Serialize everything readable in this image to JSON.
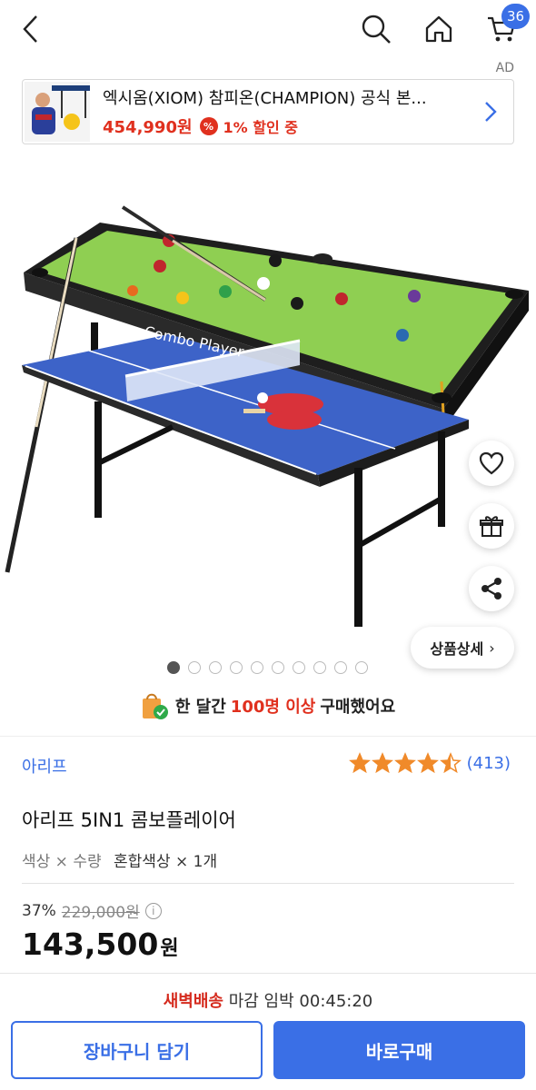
{
  "header": {
    "cart_count": "36",
    "ad_label": "AD"
  },
  "ad": {
    "title": "엑시옴(XIOM) 참피온(CHAMPION) 공식 본...",
    "price": "454,990원",
    "pct_icon": "%",
    "discount": "1% 할인 중"
  },
  "gallery": {
    "total_images": 10,
    "current_index": 1,
    "detail_label": "상품상세"
  },
  "notice": {
    "prefix": "한 달간",
    "highlight": "100명 이상",
    "suffix": "구매했어요"
  },
  "product": {
    "brand": "아리프",
    "rating_value": 4.5,
    "rating_count": "(413)",
    "name": "아리프 5IN1 콤보플레이어",
    "option_label": "색상 × 수량",
    "option_value": "혼합색상 × 1개",
    "discount_rate": "37%",
    "original_price": "229,000원",
    "price": "143,500",
    "price_unit": "원"
  },
  "footer": {
    "delivery_em": "새벽배송",
    "delivery_text": "마감 임박",
    "delivery_time": "00:45:20",
    "cart_button": "장바구니 담기",
    "buy_button": "바로구매"
  },
  "colors": {
    "accent": "#3a6fe6",
    "sale": "#e0301e",
    "star": "#f08a2a"
  }
}
